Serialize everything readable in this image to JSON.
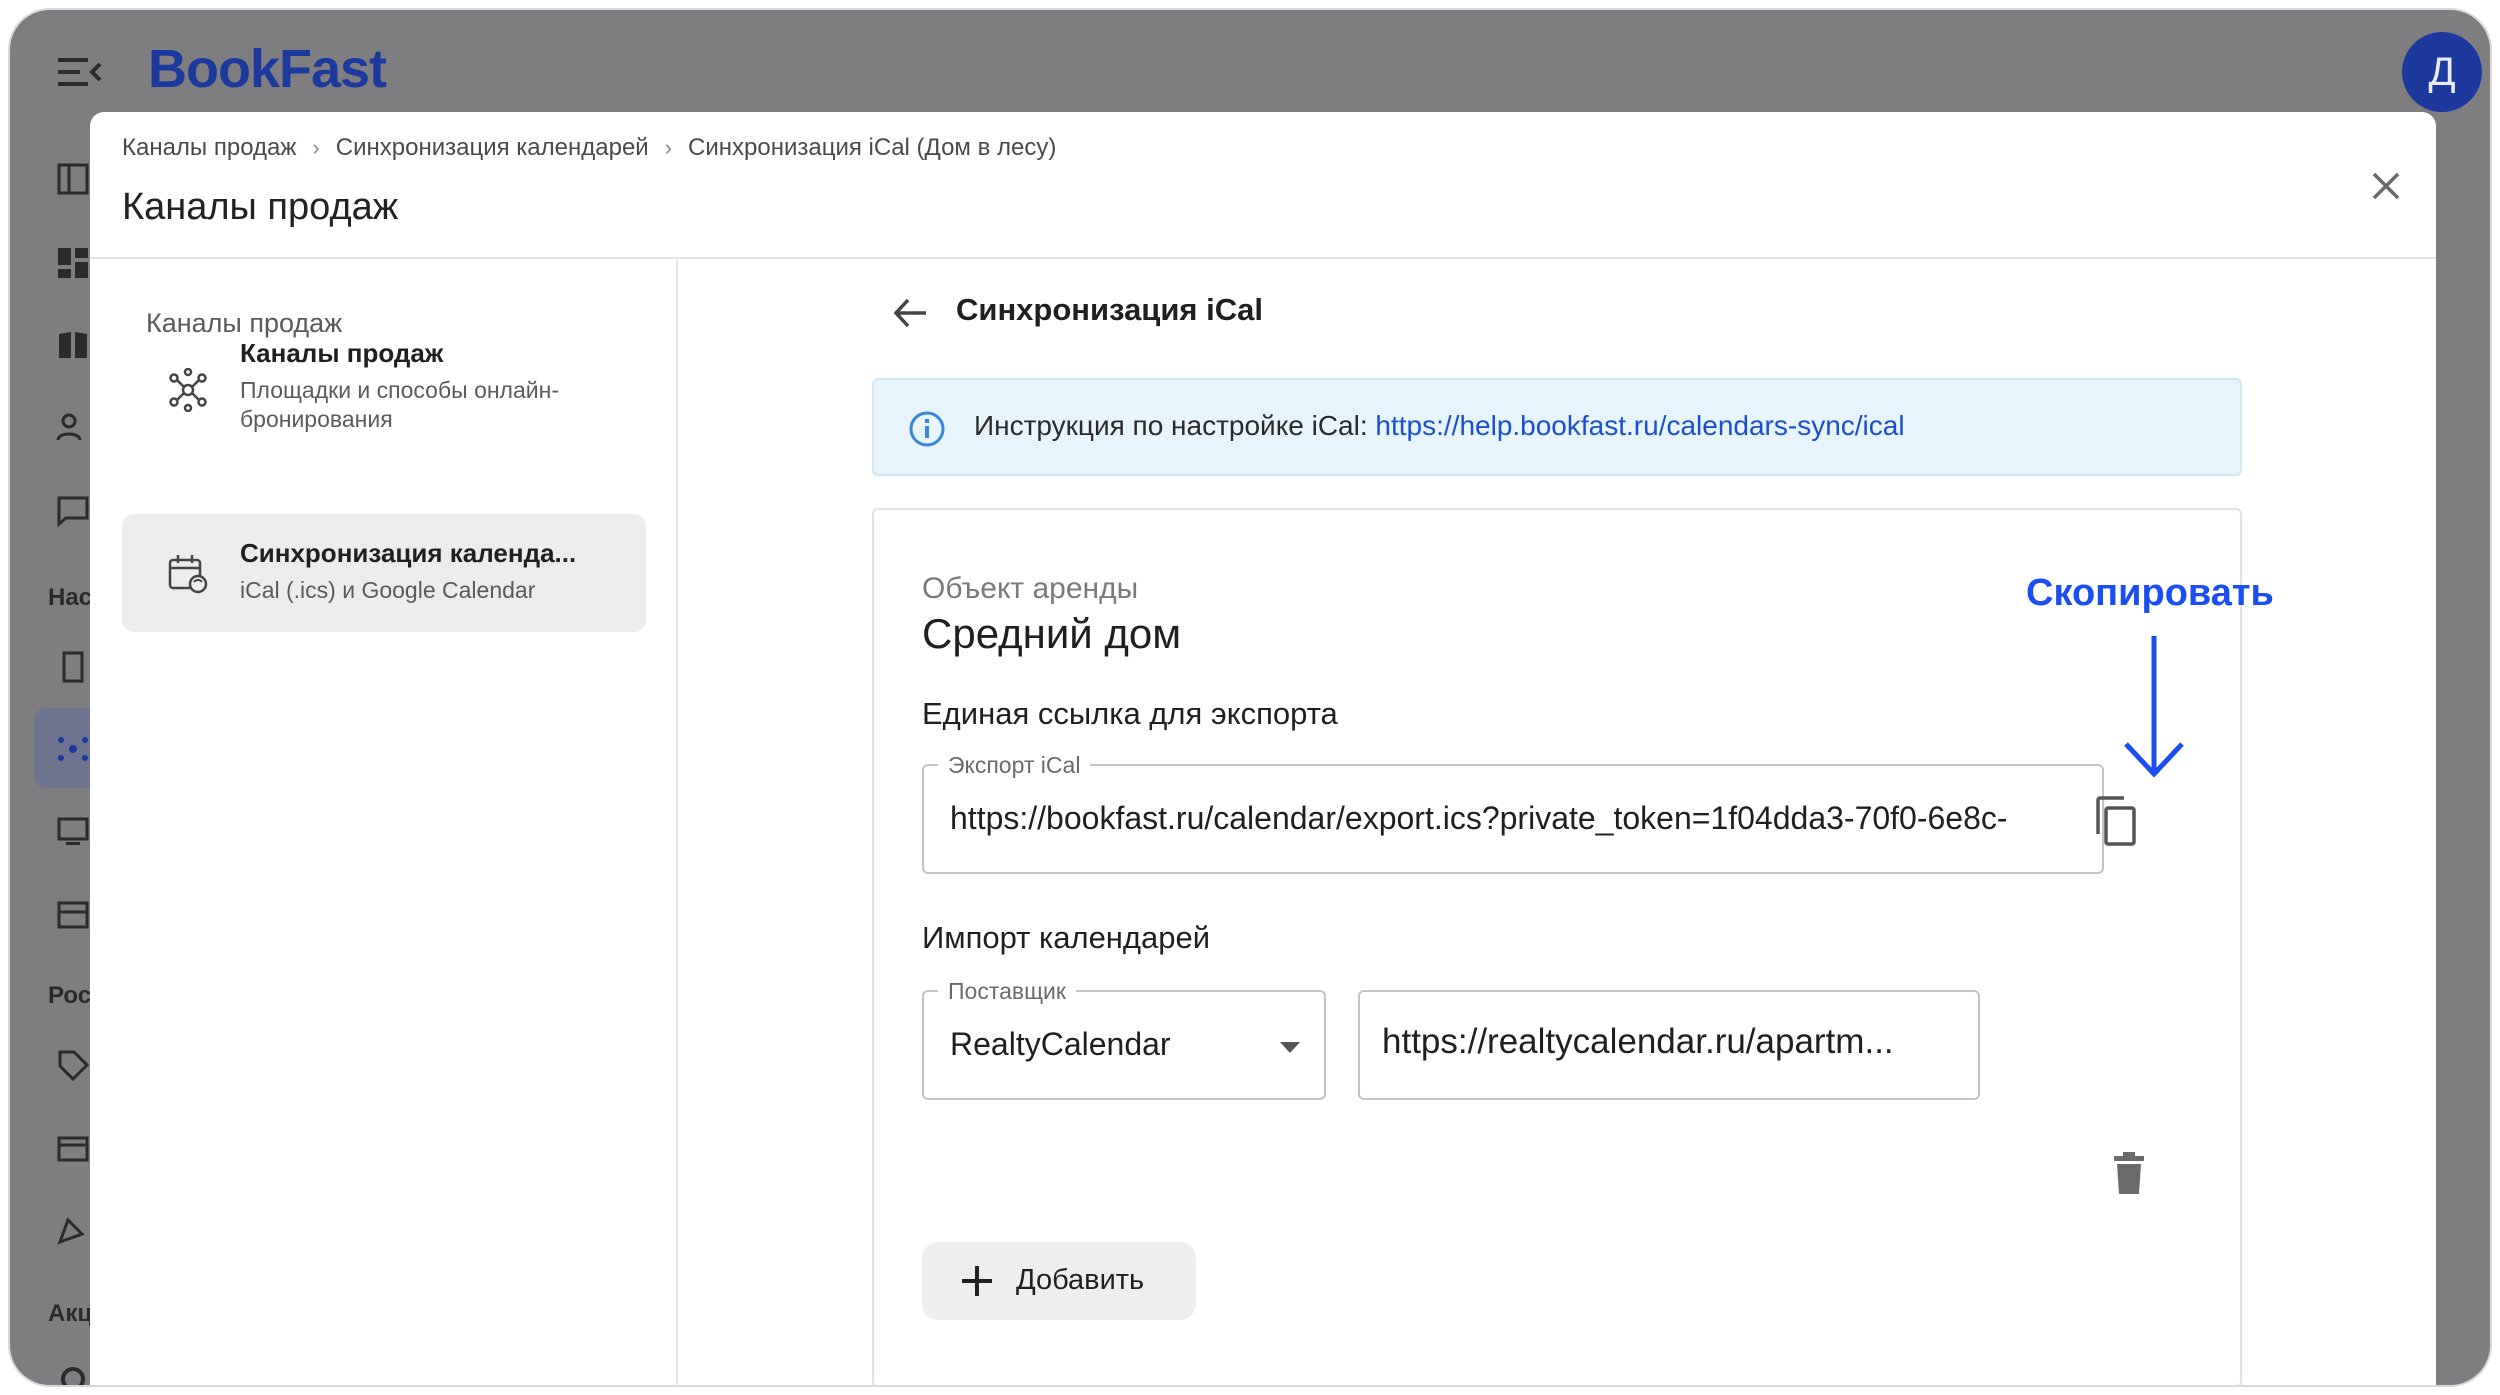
{
  "app": {
    "logo": "BookFast",
    "avatar_initial": "Д",
    "sidebar_labels": [
      "Нас",
      "Рос",
      "Акц"
    ]
  },
  "modal": {
    "breadcrumb": [
      "Каналы продаж",
      "Синхронизация календарей",
      "Синхронизация iCal (Дом в лесу)"
    ],
    "title": "Каналы продаж"
  },
  "nav": {
    "section_title": "Каналы продаж",
    "items": [
      {
        "title": "Каналы продаж",
        "subtitle": "Площадки и способы онлайн-бронирования",
        "icon": "network-icon",
        "active": false
      },
      {
        "title": "Синхронизация календа...",
        "subtitle": "iCal (.ics) и Google Calendar",
        "icon": "calendar-sync-icon",
        "active": true
      }
    ]
  },
  "panel": {
    "title": "Синхронизация iCal",
    "info_text": "Инструкция по настройке iCal: ",
    "info_link": "https://help.bookfast.ru/calendars-sync/ical",
    "object_label": "Объект аренды",
    "object_name": "Средний дом",
    "export_heading": "Единая ссылка для экспорта",
    "export_field_label": "Экспорт iCal",
    "export_url": "https://bookfast.ru/calendar/export.ics?private_token=1f04dda3-70f0-6e8c-",
    "import_heading": "Импорт календарей",
    "provider_label": "Поставщик",
    "provider_value": "RealtyCalendar",
    "import_url": "https://realtycalendar.ru/apartm...",
    "add_label": "Добавить"
  },
  "annotation": {
    "label": "Скопировать",
    "color": "#1a4ef0"
  },
  "colors": {
    "brand": "#1c3a9e",
    "link": "#1b4fd0",
    "info_bg": "#e7f4fc"
  }
}
